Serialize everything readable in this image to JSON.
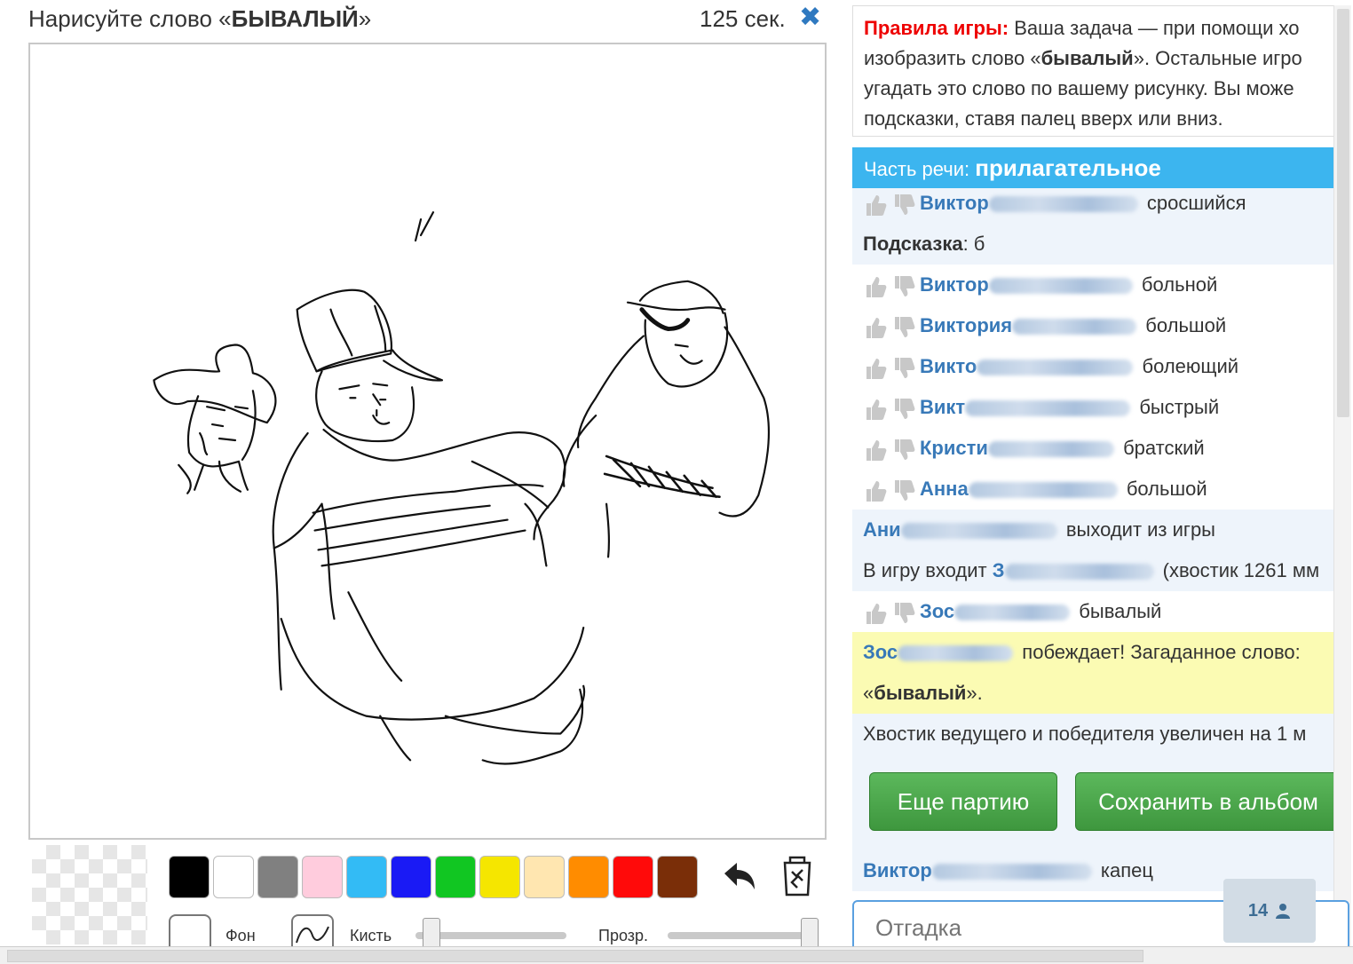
{
  "header": {
    "prompt_prefix": "Нарисуйте слово «",
    "word": "БЫВАЛЫЙ",
    "prompt_suffix": "»",
    "timer": "125 сек."
  },
  "palette": {
    "colors": [
      "#000000",
      "#ffffff",
      "#808080",
      "#ffccdd",
      "#33bbf5",
      "#1a1af5",
      "#11c622",
      "#f5e600",
      "#ffe6b0",
      "#ff8c00",
      "#ff0a0a",
      "#7a2e08"
    ]
  },
  "tools": {
    "bg_label": "Фон",
    "brush_label": "Кисть",
    "opacity_label": "Прозр.",
    "brush_size": 0.05,
    "opacity": 1.0
  },
  "rules": {
    "title": "Правила игры:",
    "line1": "Ваша задача — при помощи хо",
    "line2a": "изобразить слово «",
    "line2word": "бывалый",
    "line2b": "». Остальные игро",
    "line3": "угадать это слово по вашему рисунку. Вы може",
    "line4": "подсказки, ставя палец вверх или вниз."
  },
  "part_of_speech": {
    "label": "Часть речи:",
    "value": "прилагательное"
  },
  "chat": {
    "m0": {
      "name": "Виктор",
      "text": "сросшийся"
    },
    "hint_label": "Подсказка",
    "hint_value": ": б",
    "m1": {
      "name": "Виктор",
      "text": "больной"
    },
    "m2": {
      "name": "Виктория",
      "text": "большой"
    },
    "m3": {
      "name": "Викто",
      "text": "болеющий"
    },
    "m4": {
      "name": "Викт",
      "text": "быстрый"
    },
    "m5": {
      "name": "Кристи",
      "text": "братский"
    },
    "m6": {
      "name": "Анна",
      "text": "большой"
    },
    "m7": {
      "name": "Ани",
      "text": "выходит из игры"
    },
    "m8": {
      "prefix": "В игру входит",
      "name": "З",
      "text": "(хвостик 1261 мм"
    },
    "m9": {
      "name": "Зос",
      "text": "бывалый"
    },
    "win1": {
      "name": "Зос",
      "text": "побеждает! Загаданное слово:"
    },
    "win2": {
      "prefix": "«",
      "word": "бывалый",
      "suffix": "»."
    },
    "m10": "Хвостик ведущего и победителя увеличен на 1 м",
    "m11": {
      "name": "Виктор",
      "text": "капец"
    }
  },
  "buttons": {
    "again": "Еще партию",
    "save": "Сохранить в альбом"
  },
  "input": {
    "placeholder": "Отгадка"
  },
  "online": {
    "count": "14"
  }
}
